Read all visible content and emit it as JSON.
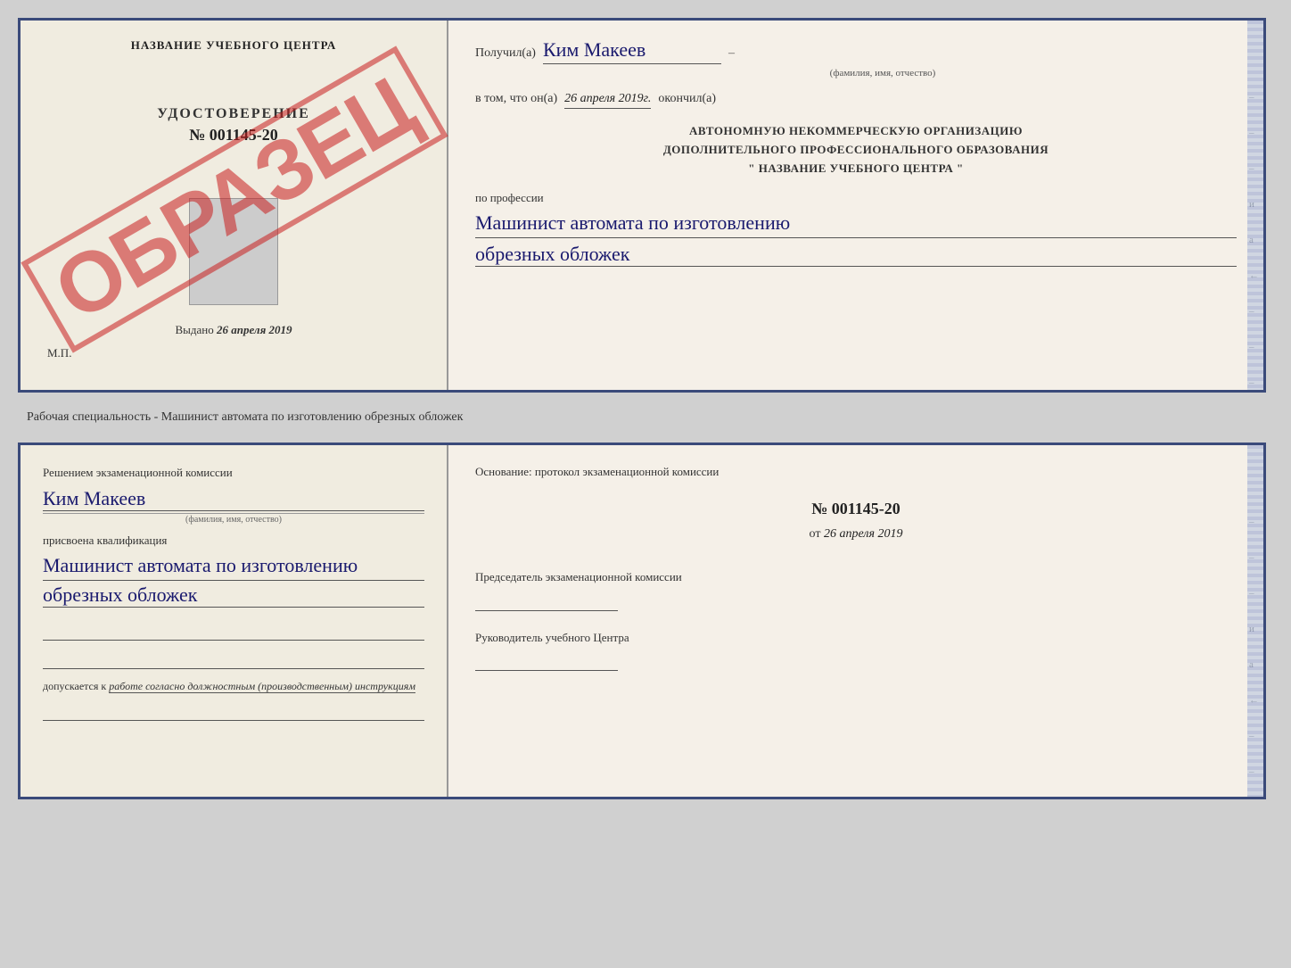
{
  "top_doc": {
    "left": {
      "training_center": "НАЗВАНИЕ УЧЕБНОГО ЦЕНТРА",
      "stamp": "ОБРАЗЕЦ",
      "udostoverenie_label": "УДОСТОВЕРЕНИЕ",
      "udostoverenie_number": "№ 001145-20",
      "vydano_prefix": "Выдано",
      "vydano_date": "26 апреля 2019",
      "mp": "М.П."
    },
    "right": {
      "poluchil": "Получил(а)",
      "name": "Ким Макеев",
      "dash": "–",
      "fio_caption": "(фамилия, имя, отчество)",
      "v_tom_prefix": "в том, что он(а)",
      "date": "26 апреля 2019г.",
      "okonchil": "окончил(а)",
      "org_line1": "АВТОНОМНУЮ НЕКОММЕРЧЕСКУЮ ОРГАНИЗАЦИЮ",
      "org_line2": "ДОПОЛНИТЕЛЬНОГО ПРОФЕССИОНАЛЬНОГО ОБРАЗОВАНИЯ",
      "org_name": "\" НАЗВАНИЕ УЧЕБНОГО ЦЕНТРА \"",
      "po_professii": "по профессии",
      "profession1": "Машинист автомата по изготовлению",
      "profession2": "обрезных обложек",
      "edge_marks": [
        "–",
        "–",
        "–",
        "–",
        "и",
        "а",
        "←",
        "–",
        "–",
        "–",
        "–"
      ]
    }
  },
  "separator": {
    "text": "Рабочая специальность - Машинист автомата по изготовлению обрезных обложек"
  },
  "bottom_doc": {
    "left": {
      "resheniem": "Решением экзаменационной комиссии",
      "name": "Ким Макеев",
      "fio_caption": "(фамилия, имя, отчество)",
      "prisvoena": "присвоена квалификация",
      "qualification1": "Машинист автомата по изготовлению",
      "qualification2": "обрезных обложек",
      "dopuskaetsya_prefix": "допускается к",
      "dopuskaetsya_text": "работе согласно должностным (производственным) инструкциям"
    },
    "right": {
      "osnovanie": "Основание: протокол экзаменационной комиссии",
      "protocol_number": "№ 001145-20",
      "ot_prefix": "от",
      "ot_date": "26 апреля 2019",
      "predsedatel_label": "Председатель экзаменационной комиссии",
      "rukovoditel_label": "Руководитель учебного Центра",
      "edge_marks": [
        "–",
        "–",
        "–",
        "–",
        "и",
        "а",
        "←",
        "–",
        "–",
        "–",
        "–"
      ]
    }
  }
}
